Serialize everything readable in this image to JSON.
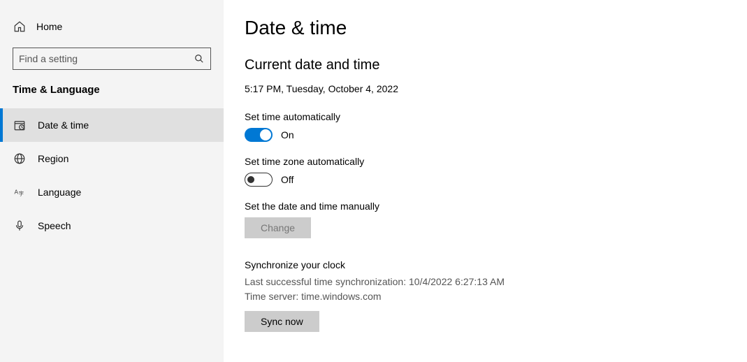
{
  "home": {
    "label": "Home"
  },
  "search": {
    "placeholder": "Find a setting"
  },
  "category": "Time & Language",
  "nav": [
    {
      "label": "Date & time",
      "active": true
    },
    {
      "label": "Region",
      "active": false
    },
    {
      "label": "Language",
      "active": false
    },
    {
      "label": "Speech",
      "active": false
    }
  ],
  "page": {
    "title": "Date & time",
    "current_section": "Current date and time",
    "current_datetime": "5:17 PM, Tuesday, October 4, 2022",
    "set_time_auto": {
      "label": "Set time automatically",
      "state": "On",
      "on": true
    },
    "set_tz_auto": {
      "label": "Set time zone automatically",
      "state": "Off",
      "on": false
    },
    "manual": {
      "label": "Set the date and time manually",
      "button": "Change"
    },
    "sync": {
      "title": "Synchronize your clock",
      "last": "Last successful time synchronization: 10/4/2022 6:27:13 AM",
      "server": "Time server: time.windows.com",
      "button": "Sync now"
    }
  }
}
